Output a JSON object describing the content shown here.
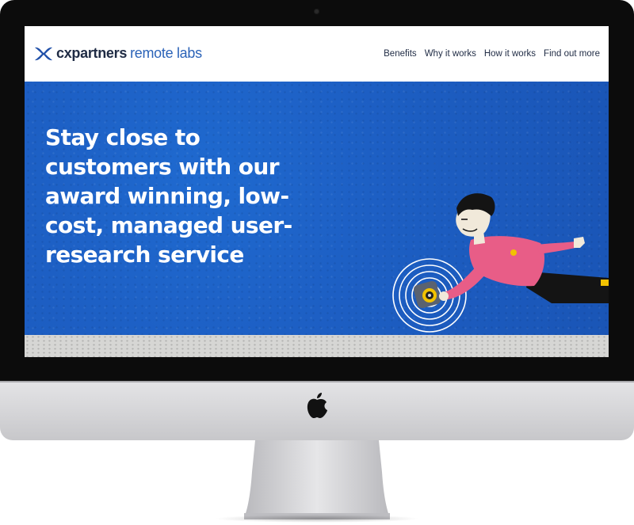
{
  "site": {
    "brand_name": "cxpartners",
    "brand_sub": "remote labs",
    "logo_icon": "cx-logo-icon",
    "colors": {
      "hero_blue": "#1d5fc4",
      "brand_dark": "#1f2b44",
      "brand_accent": "#2b63b8",
      "figure_shirt": "#e85d87"
    }
  },
  "nav": {
    "items": [
      {
        "label": "Benefits"
      },
      {
        "label": "Why it works"
      },
      {
        "label": "How it works"
      },
      {
        "label": "Find out more"
      }
    ]
  },
  "hero": {
    "headline": "Stay close to customers with our award winning, low-cost, managed user-research service",
    "illustration": "person-with-camera-illustration"
  },
  "device": {
    "type": "imac",
    "logo_icon": "apple-icon"
  }
}
